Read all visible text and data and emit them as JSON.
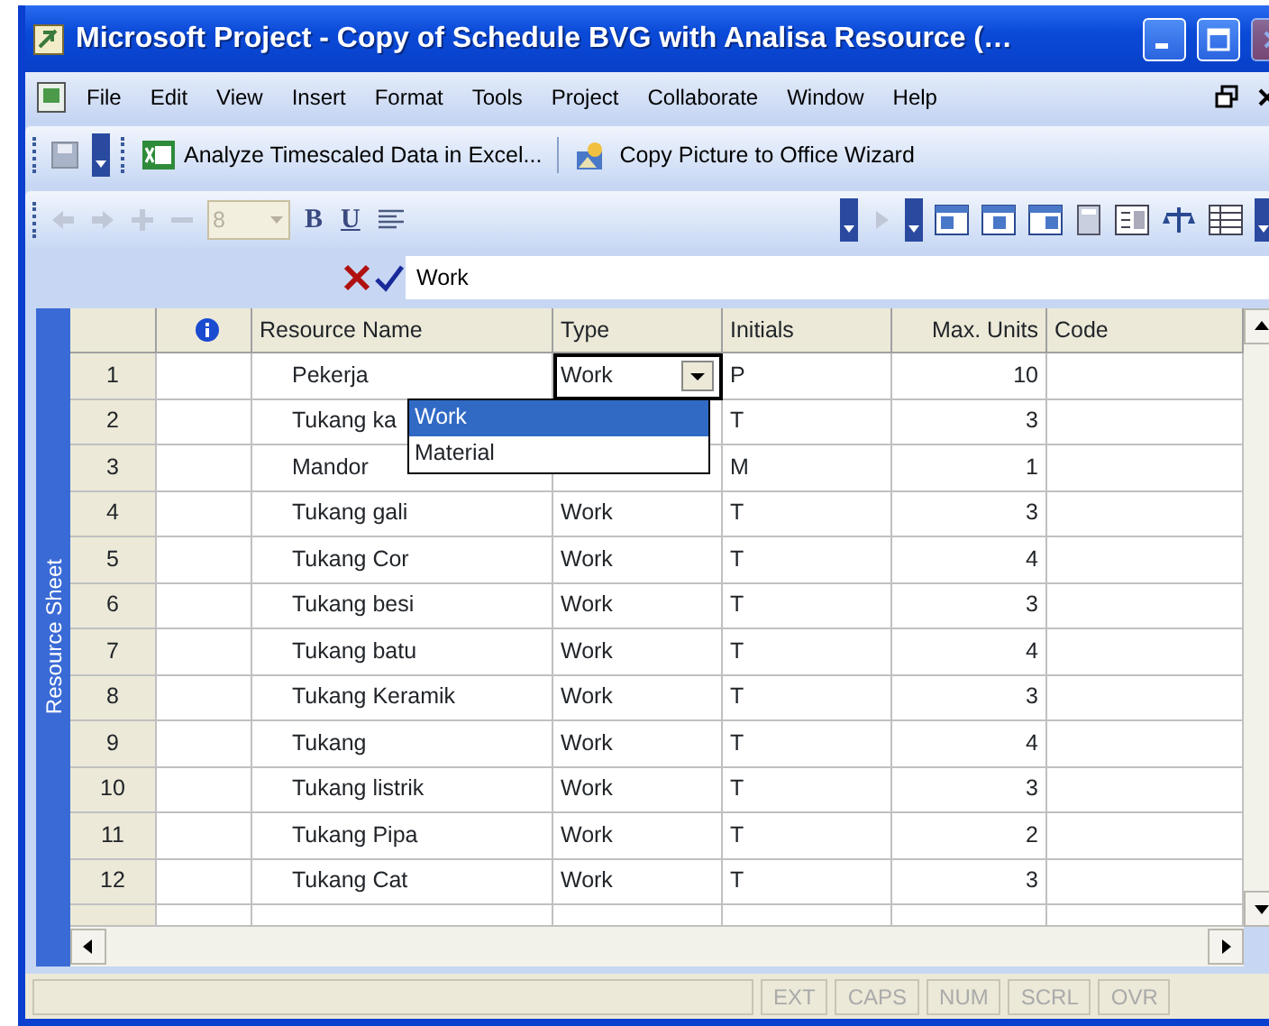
{
  "window": {
    "title": "Microsoft Project - Copy of Schedule BVG with Analisa Resource (…"
  },
  "menu": [
    "File",
    "Edit",
    "View",
    "Insert",
    "Format",
    "Tools",
    "Project",
    "Collaborate",
    "Window",
    "Help"
  ],
  "toolbar": {
    "analyze_button": "Analyze Timescaled Data in Excel...",
    "copy_picture_button": "Copy Picture to Office Wizard"
  },
  "formatting": {
    "font_size": {
      "value": "8",
      "disabled": true
    },
    "bold": "B",
    "underline": "U"
  },
  "entry_bar": {
    "value": "Work"
  },
  "sheet": {
    "view_label": "Resource Sheet",
    "columns": [
      "Resource Name",
      "Type",
      "Initials",
      "Max. Units",
      "Code"
    ],
    "rows": [
      {
        "id": "1",
        "name": "Pekerja",
        "type": "Work",
        "initials": "P",
        "max_units": "10",
        "editing": true
      },
      {
        "id": "2",
        "name": "Tukang ka",
        "initials": "T",
        "max_units": "3",
        "editing": false
      },
      {
        "id": "3",
        "name": "Mandor",
        "initials": "M",
        "max_units": "1",
        "editing": false
      },
      {
        "id": "4",
        "name": "Tukang gali",
        "type": "Work",
        "initials": "T",
        "max_units": "3",
        "editing": false
      },
      {
        "id": "5",
        "name": "Tukang Cor",
        "type": "Work",
        "initials": "T",
        "max_units": "4",
        "editing": false
      },
      {
        "id": "6",
        "name": "Tukang besi",
        "type": "Work",
        "initials": "T",
        "max_units": "3",
        "editing": false
      },
      {
        "id": "7",
        "name": "Tukang batu",
        "type": "Work",
        "initials": "T",
        "max_units": "4",
        "editing": false
      },
      {
        "id": "8",
        "name": "Tukang Keramik",
        "type": "Work",
        "initials": "T",
        "max_units": "3",
        "editing": false
      },
      {
        "id": "9",
        "name": "Tukang",
        "type": "Work",
        "initials": "T",
        "max_units": "4",
        "editing": false
      },
      {
        "id": "10",
        "name": "Tukang listrik",
        "type": "Work",
        "initials": "T",
        "max_units": "3",
        "editing": false
      },
      {
        "id": "11",
        "name": "Tukang Pipa",
        "type": "Work",
        "initials": "T",
        "max_units": "2",
        "editing": false
      },
      {
        "id": "12",
        "name": "Tukang Cat",
        "type": "Work",
        "initials": "T",
        "max_units": "3",
        "editing": false
      }
    ],
    "dropdown": {
      "options": [
        {
          "label": "Work",
          "selected": true
        },
        {
          "label": "Material",
          "selected": false
        }
      ]
    }
  },
  "status_bar": {
    "indicators": [
      {
        "label": "EXT",
        "active": false
      },
      {
        "label": "CAPS",
        "active": false
      },
      {
        "label": "NUM",
        "active": false
      },
      {
        "label": "SCRL",
        "active": false
      },
      {
        "label": "OVR",
        "active": false
      }
    ]
  }
}
